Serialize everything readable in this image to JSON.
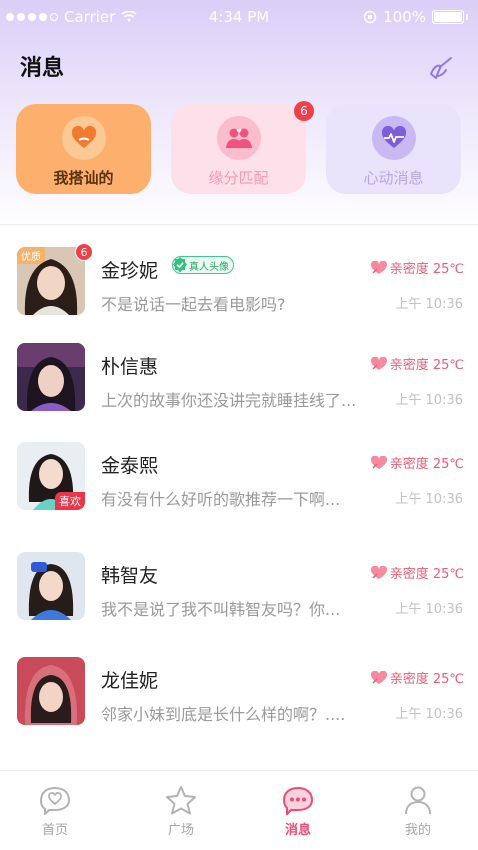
{
  "status_bar": {
    "carrier": "Carrier",
    "time": "4:34 PM",
    "battery": "100%"
  },
  "header": {
    "title": "消息",
    "clear_icon": "broom-icon"
  },
  "cards": [
    {
      "label": "我搭讪的",
      "icon": "heart-hand-icon",
      "badge": ""
    },
    {
      "label": "缘分匹配",
      "icon": "couple-icon",
      "badge": "6"
    },
    {
      "label": "心动消息",
      "icon": "heartbeat-icon",
      "badge": ""
    }
  ],
  "chats": [
    {
      "name": "金珍妮",
      "verified_label": "真人头像",
      "tag_top": "优质",
      "tag_bottom": "",
      "badge": "6",
      "intimacy": "亲密度 25℃",
      "preview": "不是说话一起去看电影吗?",
      "time": "上午 10:36"
    },
    {
      "name": "朴信惠",
      "verified_label": "",
      "tag_top": "",
      "tag_bottom": "",
      "badge": "",
      "intimacy": "亲密度 25℃",
      "preview": "上次的故事你还没讲完就睡挂线了...",
      "time": "上午 10:36"
    },
    {
      "name": "金泰熙",
      "verified_label": "",
      "tag_top": "",
      "tag_bottom": "喜欢",
      "badge": "",
      "intimacy": "亲密度 25℃",
      "preview": "有没有什么好听的歌推荐一下啊...",
      "time": "上午 10:36"
    },
    {
      "name": "韩智友",
      "verified_label": "",
      "tag_top": "",
      "tag_bottom": "",
      "badge": "",
      "intimacy": "亲密度 25℃",
      "preview": "我不是说了我不叫韩智友吗？你...",
      "time": "上午 10:36"
    },
    {
      "name": "龙佳妮",
      "verified_label": "",
      "tag_top": "",
      "tag_bottom": "",
      "badge": "",
      "intimacy": "亲密度 25℃",
      "preview": "邻家小妹到底是长什么样的啊？....",
      "time": "上午 10:36"
    }
  ],
  "tabs": [
    {
      "label": "首页",
      "icon": "heart-chat-icon",
      "active": false
    },
    {
      "label": "广场",
      "icon": "star-icon",
      "active": false
    },
    {
      "label": "消息",
      "icon": "message-icon",
      "active": true
    },
    {
      "label": "我的",
      "icon": "person-icon",
      "active": false
    }
  ],
  "colors": {
    "accent": "#f04a75",
    "intimacy": "#ee5a73",
    "badge": "#f03f49"
  }
}
